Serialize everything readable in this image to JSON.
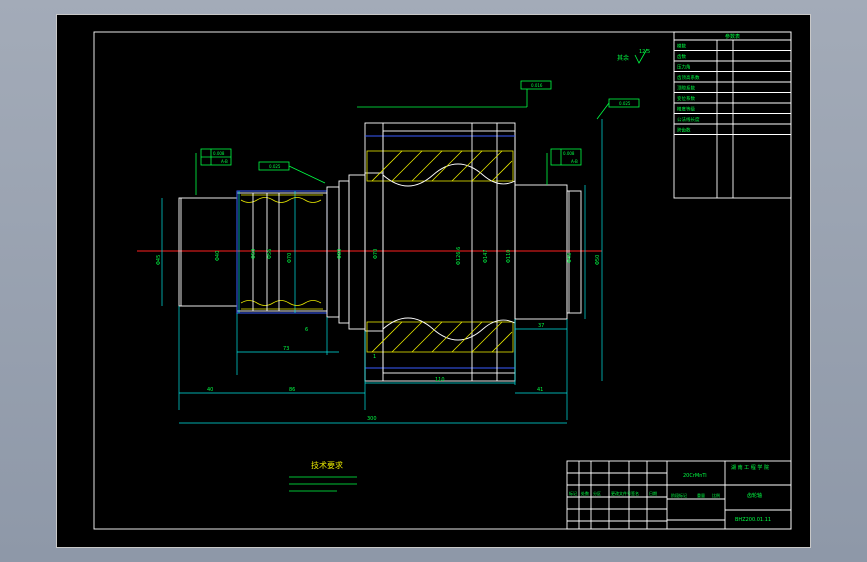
{
  "drawing": {
    "technical_requirements_title": "技术要求",
    "title_block": {
      "material": "20CrMnTi",
      "company": "湖 南 工 程 学 院",
      "part_name": "齿轮轴",
      "drawing_no": "BHZ200.01.11",
      "row_labels": [
        "标记",
        "处数",
        "分区",
        "更改文件号",
        "签名",
        "日期"
      ],
      "stage_labels": [
        "阶段标记",
        "重量",
        "比例"
      ]
    },
    "roughness_label": "其余",
    "roughness_value": "12.5",
    "param_table_title": "参数表",
    "gear_table_rows": [
      "模数",
      "齿数",
      "压力角",
      "齿顶高系数",
      "顶隙系数",
      "变位系数",
      "精度等级",
      "公法线长度",
      "跨齿数"
    ],
    "dims": {
      "d_left_shaft": "Φ45",
      "d_spline": "Φ40",
      "d_shaft2": "Φ50",
      "d_shaft3": "Φ56",
      "d_collar": "Φ70",
      "d_hub": "Φ80",
      "d_gear_root": "Φ126.6",
      "d_gear_ref": "Φ147",
      "d_gear_right": "Φ110",
      "d_right_shaft": "Φ45",
      "d_right_shaft2": "Φ50",
      "len_spline": "73",
      "len_left": "40",
      "len_mid": "86",
      "len_gear": "110",
      "len_right": "41",
      "len_total": "300",
      "len_right_step": "37",
      "small_6": "6",
      "small_1": "1"
    },
    "tolerance_frames": [
      "0.008",
      "A-B",
      "0.025",
      "A-B",
      "0.016",
      "A-B",
      "0.025",
      "A-B"
    ]
  }
}
